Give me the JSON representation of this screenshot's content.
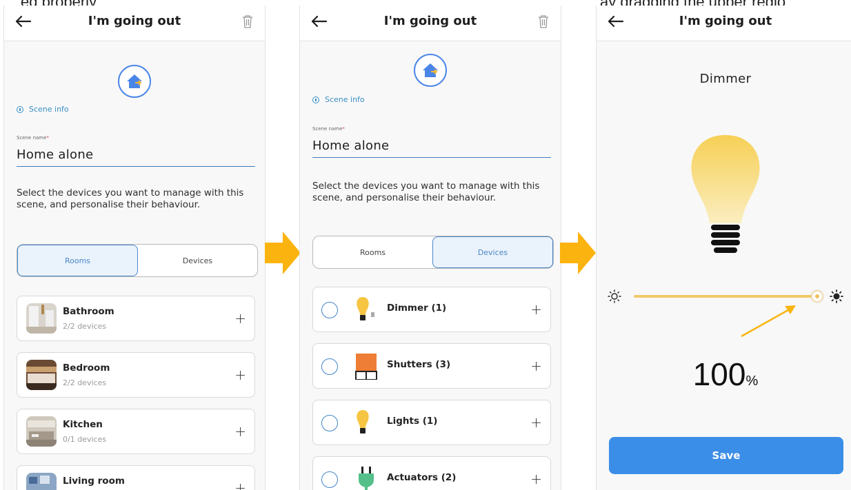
{
  "caption": {
    "left": "ed properly",
    "right": "ay dragging the upper regio"
  },
  "screen1": {
    "title": "I'm going out",
    "scene_info": "Scene info",
    "field_label": "Scene name",
    "field_required": "*",
    "scene_name": "Home alone",
    "description": "Select the devices you want to manage with this scene, and personalise their behaviour.",
    "tabs": [
      "Rooms",
      "Devices"
    ],
    "active_tab": "Rooms",
    "rooms": [
      {
        "name": "Bathroom",
        "count": "2/2 devices"
      },
      {
        "name": "Bedroom",
        "count": "2/2 devices"
      },
      {
        "name": "Kitchen",
        "count": "0/1 devices"
      },
      {
        "name": "Living room",
        "count": ""
      }
    ]
  },
  "screen2": {
    "title": "I'm going out",
    "scene_info": "Scene info",
    "field_label": "Scene name",
    "field_required": "*",
    "scene_name": "Home alone",
    "description": "Select the devices you want to manage with this scene, and personalise their behaviour.",
    "tabs": [
      "Rooms",
      "Devices"
    ],
    "active_tab": "Devices",
    "devices": [
      {
        "name": "Dimmer (1)",
        "icon": "bulb-dimmer-icon"
      },
      {
        "name": "Shutters (3)",
        "icon": "shutter-icon"
      },
      {
        "name": "Lights (1)",
        "icon": "bulb-icon"
      },
      {
        "name": "Actuators (2)",
        "icon": "plug-icon"
      }
    ]
  },
  "screen3": {
    "title": "I'm going out",
    "device_name": "Dimmer",
    "level_value": "100",
    "level_unit": "%",
    "level_fraction": 1.0,
    "save_label": "Save"
  },
  "plus_symbol": "+",
  "colors": {
    "accent_blue": "#3b8ee8",
    "tab_active": "#4a86c8",
    "arrow_orange": "#fbb40f",
    "bulb_yellow": "#f6cf55",
    "slider": "#f0c96a"
  }
}
